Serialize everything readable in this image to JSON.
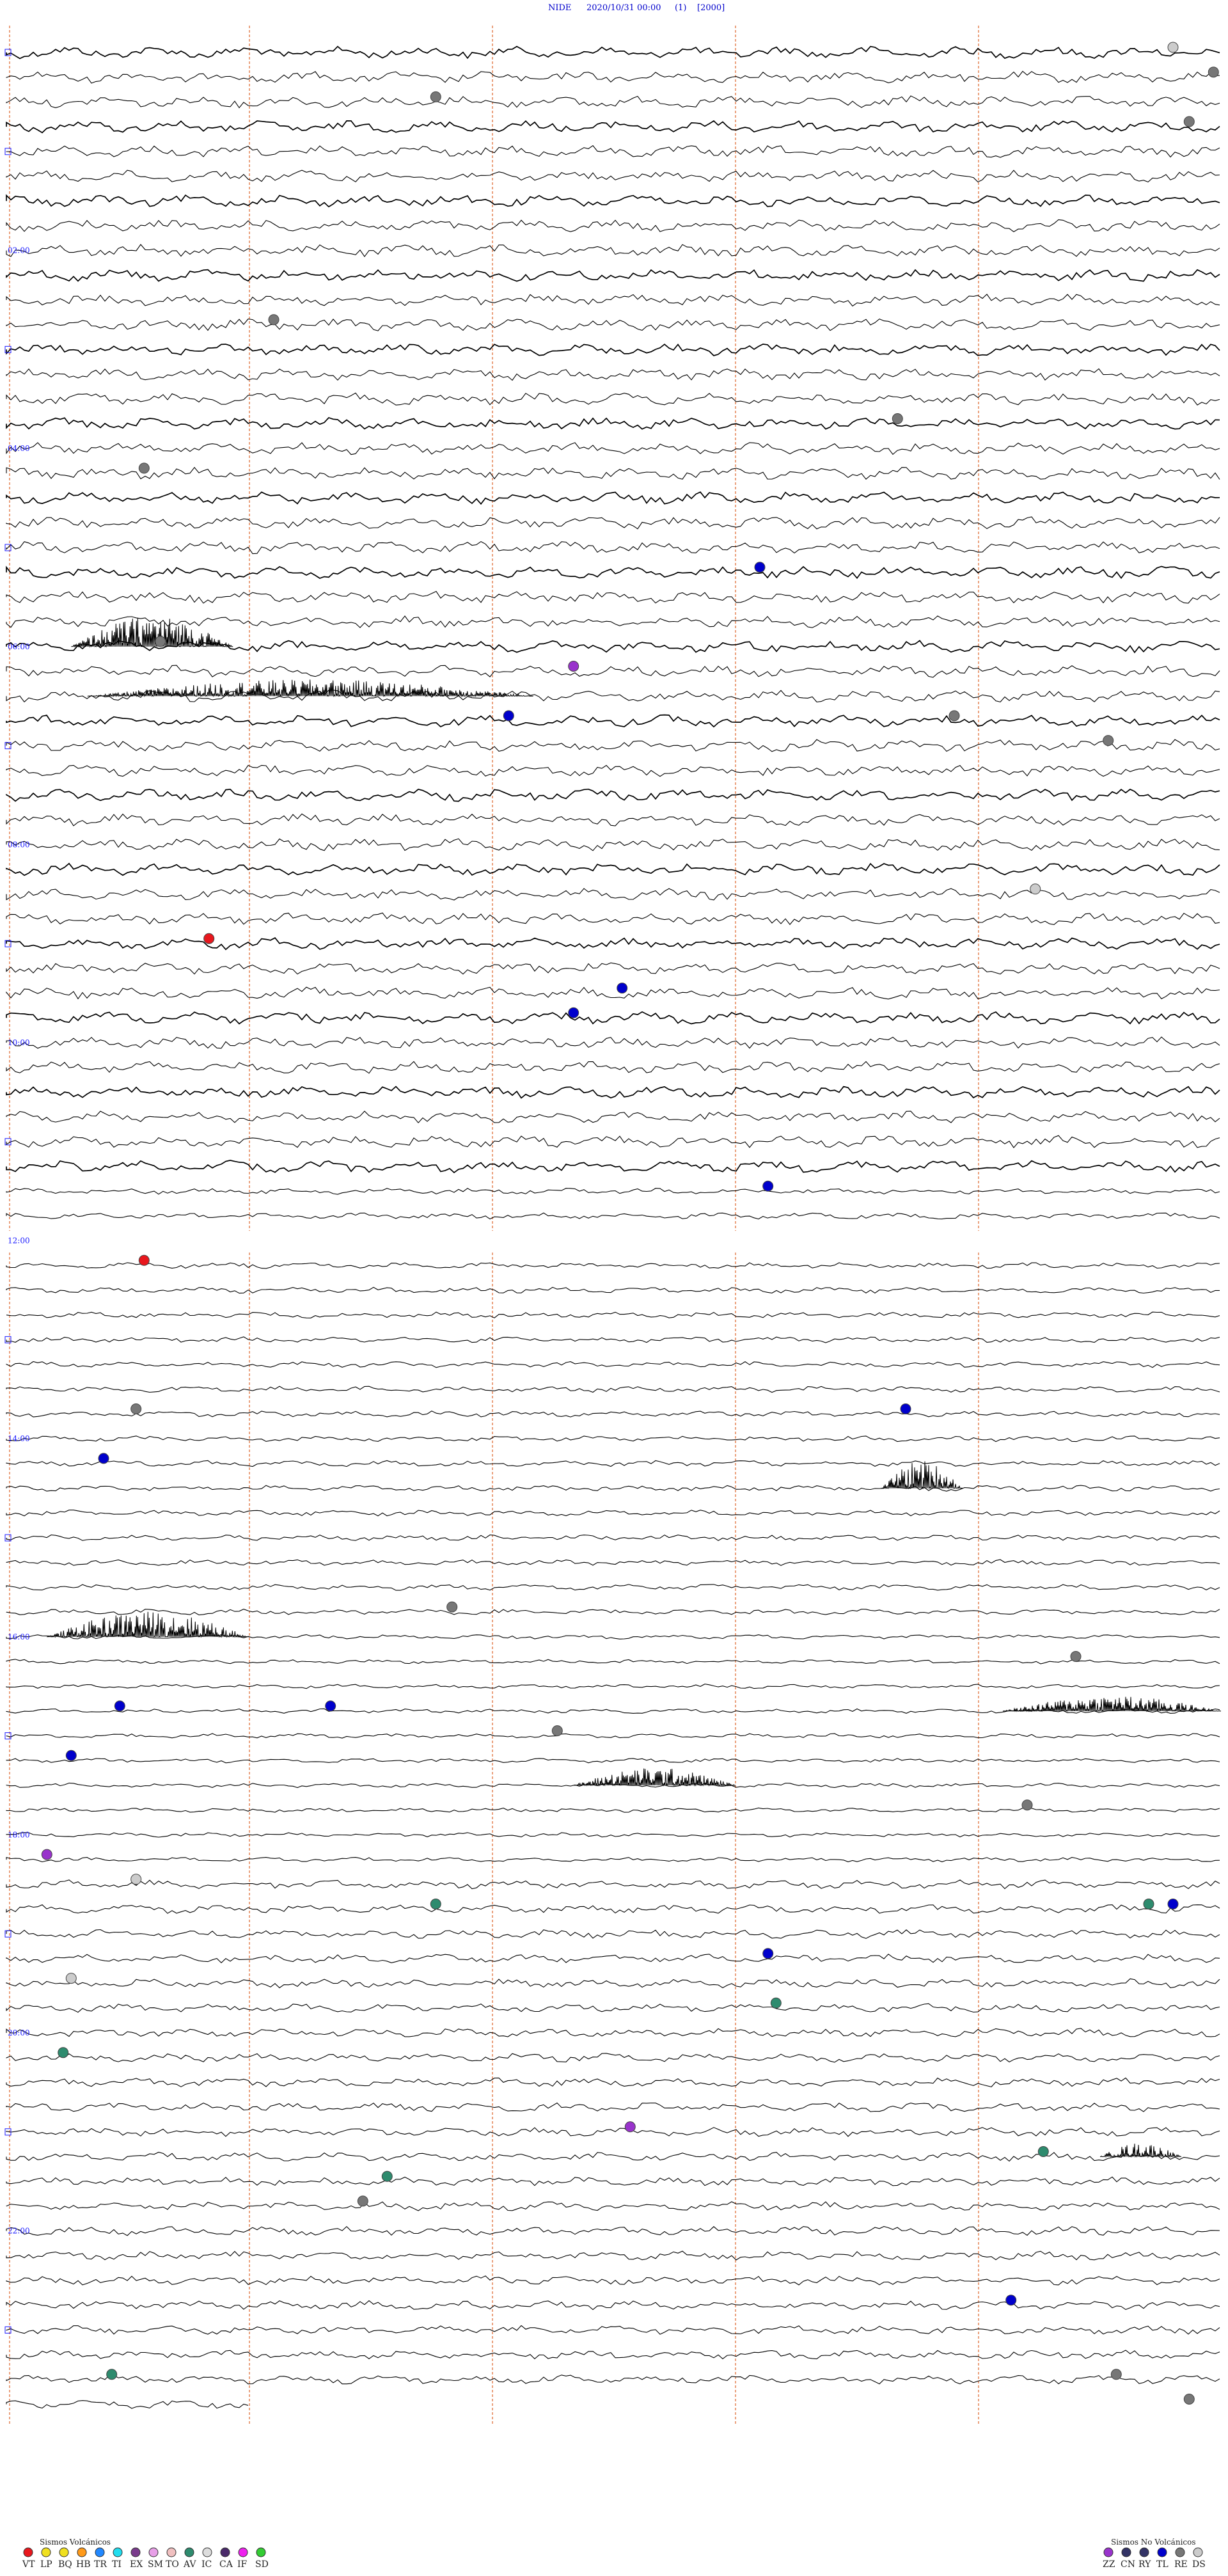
{
  "header": {
    "station": "NIDE",
    "datetime": "2020/10/31 00:00",
    "channel": "(1)",
    "scale": "[2000]"
  },
  "hour_labels": [
    "02:00",
    "04:00",
    "06:00",
    "08:00",
    "10:00",
    "12:00",
    "14:00",
    "16:00",
    "18:00",
    "20:00",
    "22:00"
  ],
  "legend": {
    "volcanic_title": "Sismos Volcánicos",
    "volcanic": [
      {
        "code": "VT",
        "color": "#e8171d"
      },
      {
        "code": "LP",
        "color": "#f0e020"
      },
      {
        "code": "BQ",
        "color": "#f0e020"
      },
      {
        "code": "HB",
        "color": "#ff9a1a"
      },
      {
        "code": "TR",
        "color": "#2288ff"
      },
      {
        "code": "TI",
        "color": "#22ddee"
      },
      {
        "code": "EX",
        "color": "#7a3b8c"
      },
      {
        "code": "SM",
        "color": "#e8a0e8"
      },
      {
        "code": "TO",
        "color": "#f0c0c0"
      },
      {
        "code": "AV",
        "color": "#2e8b6e"
      },
      {
        "code": "IC",
        "color": "#dddddd"
      },
      {
        "code": "CA",
        "color": "#4a2a6a"
      },
      {
        "code": "IF",
        "color": "#ee22ee"
      },
      {
        "code": "SD",
        "color": "#33cc33"
      }
    ],
    "nonvolcanic_title": "Sismos No Volcánicos",
    "nonvolcanic": [
      {
        "code": "ZZ",
        "color": "#9933cc"
      },
      {
        "code": "CN",
        "color": "#333366"
      },
      {
        "code": "RY",
        "color": "#333366"
      },
      {
        "code": "TL",
        "color": "#0000cc"
      },
      {
        "code": "RE",
        "color": "#777777"
      },
      {
        "code": "DS",
        "color": "#cccccc"
      }
    ]
  },
  "chart_data": {
    "type": "line",
    "title": "NIDE 2020/10/31 00:00 (1) [2000]",
    "x_unit": "minutes within trace line",
    "y_unit": "time of day (15-minute helicorder lines)",
    "lines": 96,
    "minutes_per_line": 15,
    "event_colors": {
      "VT": "#e8171d",
      "AV": "#2e8b6e",
      "ZZ": "#9933cc",
      "TL": "#0000cc",
      "RE": "#777777",
      "DS": "#cccccc"
    },
    "events": [
      {
        "type": "DS",
        "line": 0,
        "minute": 14.4
      },
      {
        "type": "RE",
        "line": 1,
        "minute": 14.9
      },
      {
        "type": "RE",
        "line": 2,
        "minute": 5.3
      },
      {
        "type": "RE",
        "line": 3,
        "minute": 14.6
      },
      {
        "type": "RE",
        "line": 11,
        "minute": 3.3
      },
      {
        "type": "RE",
        "line": 15,
        "minute": 11.0
      },
      {
        "type": "RE",
        "line": 17,
        "minute": 1.7
      },
      {
        "type": "TL",
        "line": 21,
        "minute": 9.3
      },
      {
        "type": "RE",
        "line": 24,
        "minute": 1.9
      },
      {
        "type": "ZZ",
        "line": 25,
        "minute": 7.0
      },
      {
        "type": "TL",
        "line": 27,
        "minute": 6.2
      },
      {
        "type": "RE",
        "line": 27,
        "minute": 11.7
      },
      {
        "type": "RE",
        "line": 28,
        "minute": 13.6
      },
      {
        "type": "DS",
        "line": 34,
        "minute": 12.7
      },
      {
        "type": "VT",
        "line": 36,
        "minute": 2.5
      },
      {
        "type": "TL",
        "line": 38,
        "minute": 7.6
      },
      {
        "type": "TL",
        "line": 39,
        "minute": 7.0
      },
      {
        "type": "TL",
        "line": 46,
        "minute": 9.4
      },
      {
        "type": "VT",
        "line": 49,
        "minute": 1.7
      },
      {
        "type": "RE",
        "line": 55,
        "minute": 1.6
      },
      {
        "type": "TL",
        "line": 55,
        "minute": 11.1
      },
      {
        "type": "TL",
        "line": 57,
        "minute": 1.2
      },
      {
        "type": "RE",
        "line": 63,
        "minute": 5.5
      },
      {
        "type": "RE",
        "line": 65,
        "minute": 13.2
      },
      {
        "type": "TL",
        "line": 67,
        "minute": 1.4
      },
      {
        "type": "TL",
        "line": 67,
        "minute": 4.0
      },
      {
        "type": "RE",
        "line": 68,
        "minute": 6.8
      },
      {
        "type": "TL",
        "line": 69,
        "minute": 0.8
      },
      {
        "type": "RE",
        "line": 71,
        "minute": 12.6
      },
      {
        "type": "ZZ",
        "line": 73,
        "minute": 0.5
      },
      {
        "type": "DS",
        "line": 74,
        "minute": 1.6
      },
      {
        "type": "AV",
        "line": 75,
        "minute": 5.3
      },
      {
        "type": "AV",
        "line": 75,
        "minute": 14.1
      },
      {
        "type": "TL",
        "line": 75,
        "minute": 14.4
      },
      {
        "type": "TL",
        "line": 77,
        "minute": 9.4
      },
      {
        "type": "DS",
        "line": 78,
        "minute": 0.8
      },
      {
        "type": "AV",
        "line": 79,
        "minute": 9.5
      },
      {
        "type": "AV",
        "line": 81,
        "minute": 0.7
      },
      {
        "type": "ZZ",
        "line": 84,
        "minute": 7.7
      },
      {
        "type": "AV",
        "line": 85,
        "minute": 12.8
      },
      {
        "type": "AV",
        "line": 86,
        "minute": 4.7
      },
      {
        "type": "RE",
        "line": 87,
        "minute": 4.4
      },
      {
        "type": "TL",
        "line": 91,
        "minute": 12.4
      },
      {
        "type": "AV",
        "line": 94,
        "minute": 1.3
      },
      {
        "type": "RE",
        "line": 94,
        "minute": 13.7
      },
      {
        "type": "RE",
        "line": 95,
        "minute": 14.6
      }
    ]
  }
}
